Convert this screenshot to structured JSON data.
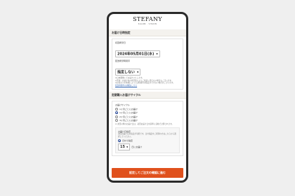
{
  "brand": {
    "logo": "STEFANY",
    "subtitle": "SALON · VISION"
  },
  "delivery_section": {
    "title": "お届け日時指定",
    "date_label": "初回希望日",
    "date_value": "2024年05月01日(水)",
    "time_label": "配送希望時間帯",
    "time_value": "指定しない",
    "notes": [
      "※日本郵便にてお届けいたします。",
      "※天候・お届け先の状況等によりご指定に添えない場合もございます。",
      "※お住まいの地域によっては時間帯の指定ができない場合がございます。"
    ],
    "link_text": "配送時間帯の詳細はこちら"
  },
  "cycle_section": {
    "title": "定期購入お届けサイクル",
    "subtitle": "お届けサイクル",
    "options": [
      {
        "label": "1ヶ月ごとにお届け",
        "selected": false
      },
      {
        "label": "1ヶ月ごとにお届け",
        "selected": true
      },
      {
        "label": "2ヶ月ごとにお届け",
        "selected": false
      },
      {
        "label": "3ヶ月ごとにお届け",
        "selected": false
      }
    ],
    "footnote": "※ 次回以降のお届け日は、初回お届け日を基準に自動で計算されます。",
    "inner": {
      "label": "お届け日指定",
      "note": "次回お届け日の指定が可能です。日付指定をご希望の方はこちらから選択してください。",
      "radio_label": "日付で指定",
      "number_value": "15",
      "unit": "日にお届け"
    }
  },
  "cta": {
    "label": "設定してご注文の確認に進む"
  }
}
